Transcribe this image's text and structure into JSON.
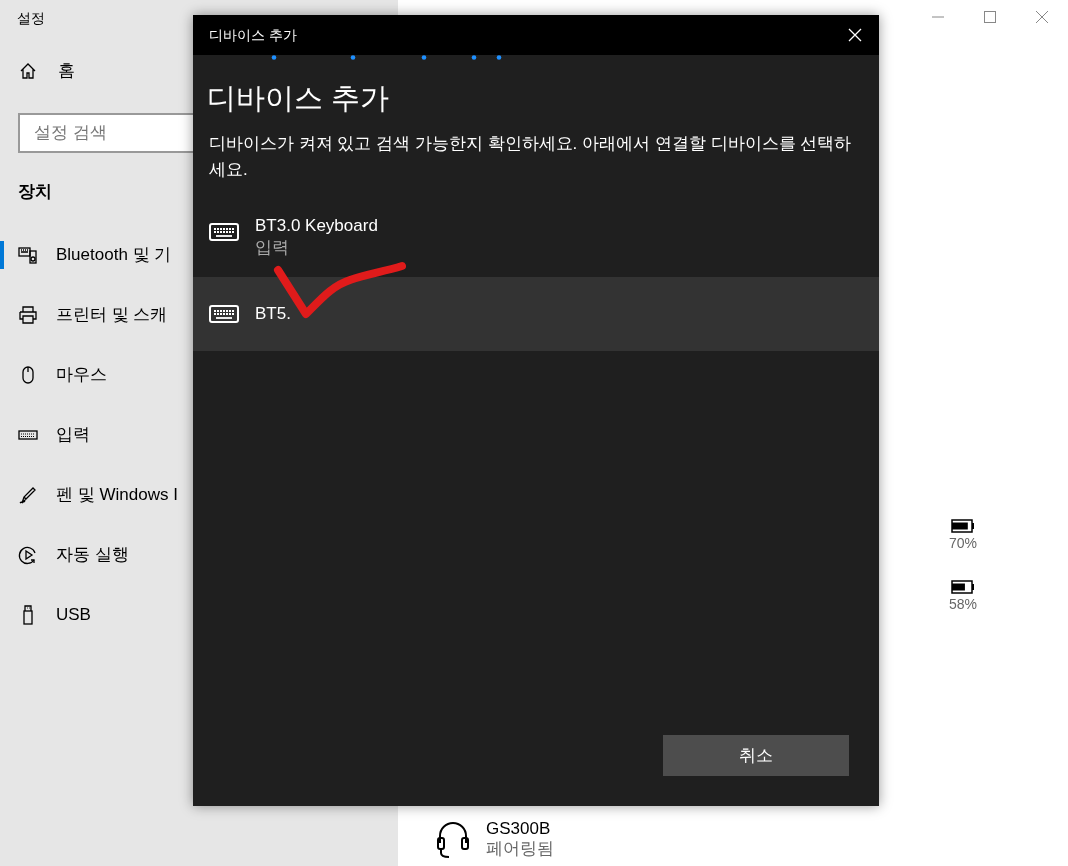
{
  "window": {
    "title": "설정"
  },
  "sidebar": {
    "home": "홈",
    "search": {
      "placeholder": "설정 검색"
    },
    "section": "장치",
    "items": [
      {
        "label": "Bluetooth 및 기",
        "selected": true
      },
      {
        "label": "프린터 및 스캐",
        "selected": false
      },
      {
        "label": "마우스",
        "selected": false
      },
      {
        "label": "입력",
        "selected": false
      },
      {
        "label": "펜 및 Windows I",
        "selected": false
      },
      {
        "label": "자동 실행",
        "selected": false
      },
      {
        "label": "USB",
        "selected": false
      }
    ]
  },
  "content": {
    "batteries": [
      {
        "reading": "70%",
        "level": 0.7
      },
      {
        "reading": "58%",
        "level": 0.58
      }
    ],
    "device": {
      "name": "GS300B",
      "status": "페어링됨"
    }
  },
  "dialog": {
    "title": "디바이스 추가",
    "heading": "디바이스 추가",
    "description": "디바이스가 켜져 있고 검색 가능한지 확인하세요. 아래에서 연결할 디바이스를 선택하세요.",
    "devices": [
      {
        "name": "BT3.0 Keyboard",
        "type": "입력",
        "selected": false
      },
      {
        "name": "BT5.",
        "selected": true
      }
    ],
    "cancel": "취소"
  }
}
